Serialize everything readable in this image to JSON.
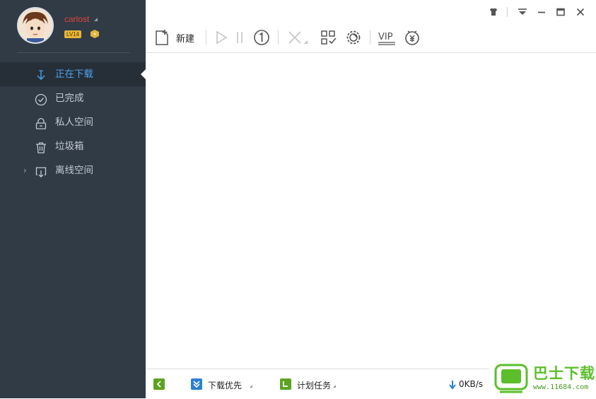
{
  "user": {
    "name": "carlost",
    "level": "LV14"
  },
  "sidebar": {
    "items": [
      {
        "label": "正在下载",
        "icon": "download-arrow-icon",
        "active": true
      },
      {
        "label": "已完成",
        "icon": "check-circle-icon",
        "active": false
      },
      {
        "label": "私人空间",
        "icon": "lock-icon",
        "active": false
      },
      {
        "label": "垃圾箱",
        "icon": "trash-icon",
        "active": false
      },
      {
        "label": "离线空间",
        "icon": "cloud-download-icon",
        "active": false
      }
    ]
  },
  "toolbar": {
    "new_label": "新建"
  },
  "statusbar": {
    "priority_label": "下载优先",
    "schedule_label": "计划任务",
    "speed": "0KB/s"
  },
  "watermark": {
    "text": "巴士下载",
    "url": "www.11684.com"
  },
  "colors": {
    "sidebar_bg": "#303b46",
    "active_item": "#4da2ee",
    "username": "#e0463a",
    "status_green": "#5ba320",
    "status_blue": "#2b7fd4"
  }
}
